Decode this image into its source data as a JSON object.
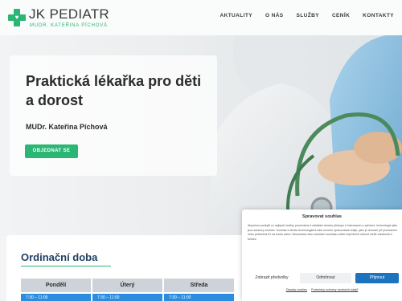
{
  "header": {
    "logo_title": "JK PEDIATR",
    "logo_subtitle": "MUDR. KATEŘINA PÍCHOVÁ",
    "nav": [
      "AKTUALITY",
      "O NÁS",
      "SLUŽBY",
      "CENÍK",
      "KONTAKTY"
    ]
  },
  "hero": {
    "title": "Praktická lékařka pro děti a dorost",
    "doctor": "MUDr. Kateřina Píchová",
    "button": "OBJEDNAT SE"
  },
  "hours": {
    "title": "Ordinační doba",
    "columns": [
      "Pondělí",
      "Úterý",
      "Středa"
    ],
    "row_values": [
      "7:30 – 11:00",
      "7:30 – 11:00",
      "7:30 – 11:00"
    ]
  },
  "cookie": {
    "title": "Spravovat souhlas",
    "text": "Abychom poskytli co nejlepší služby, používáme k ukládání a/nebo přístupu k informacím o zařízení, technologie jako jsou soubory cookies. Souhlas s těmito technologiemi nám umožní zpracovávat údaje, jako je chování při procházení nebo jedinečná ID na tomto webu. Nesouhlas nebo odvolání souhlasu může nepříznivě ovlivnit určité vlastnosti a funkce.",
    "btn_preferences": "Zobrazit předvolby",
    "btn_deny": "Odmítnout",
    "btn_accept": "Přijmout",
    "link_cookie_policy": "Zásady cookies",
    "link_privacy": "Podmínky ochrany osobních údajů"
  },
  "colors": {
    "brand_green": "#2bb673",
    "heading_blue": "#1f3f64",
    "accept_blue": "#1e73be",
    "table_blue": "#2b8de0"
  }
}
